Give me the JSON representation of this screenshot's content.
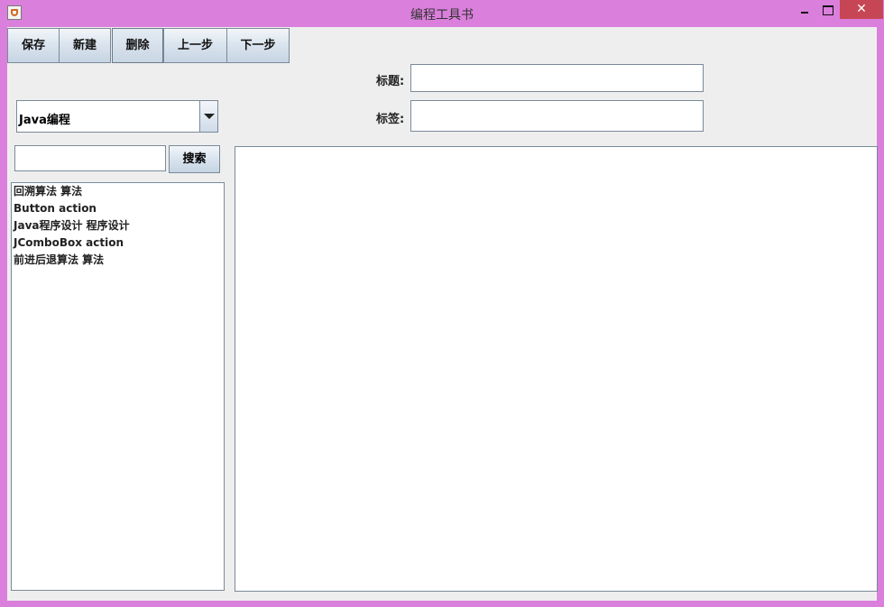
{
  "window": {
    "title": "编程工具书",
    "close_glyph": "✕"
  },
  "toolbar": {
    "buttons": [
      {
        "label": "保存"
      },
      {
        "label": "新建"
      },
      {
        "label": "删除"
      },
      {
        "label": "上一步"
      },
      {
        "label": "下一步"
      }
    ]
  },
  "form": {
    "title_label": "标题:",
    "title_value": "",
    "tag_label": "标签:",
    "tag_value": ""
  },
  "category": {
    "selected": "Java编程"
  },
  "search": {
    "query": "",
    "button_label": "搜索"
  },
  "entries": [
    {
      "text": "回溯算法 算法"
    },
    {
      "text": "Button action"
    },
    {
      "text": "Java程序设计 程序设计"
    },
    {
      "text": "JComboBox action"
    },
    {
      "text": "前进后退算法 算法"
    }
  ],
  "editor": {
    "content": ""
  }
}
